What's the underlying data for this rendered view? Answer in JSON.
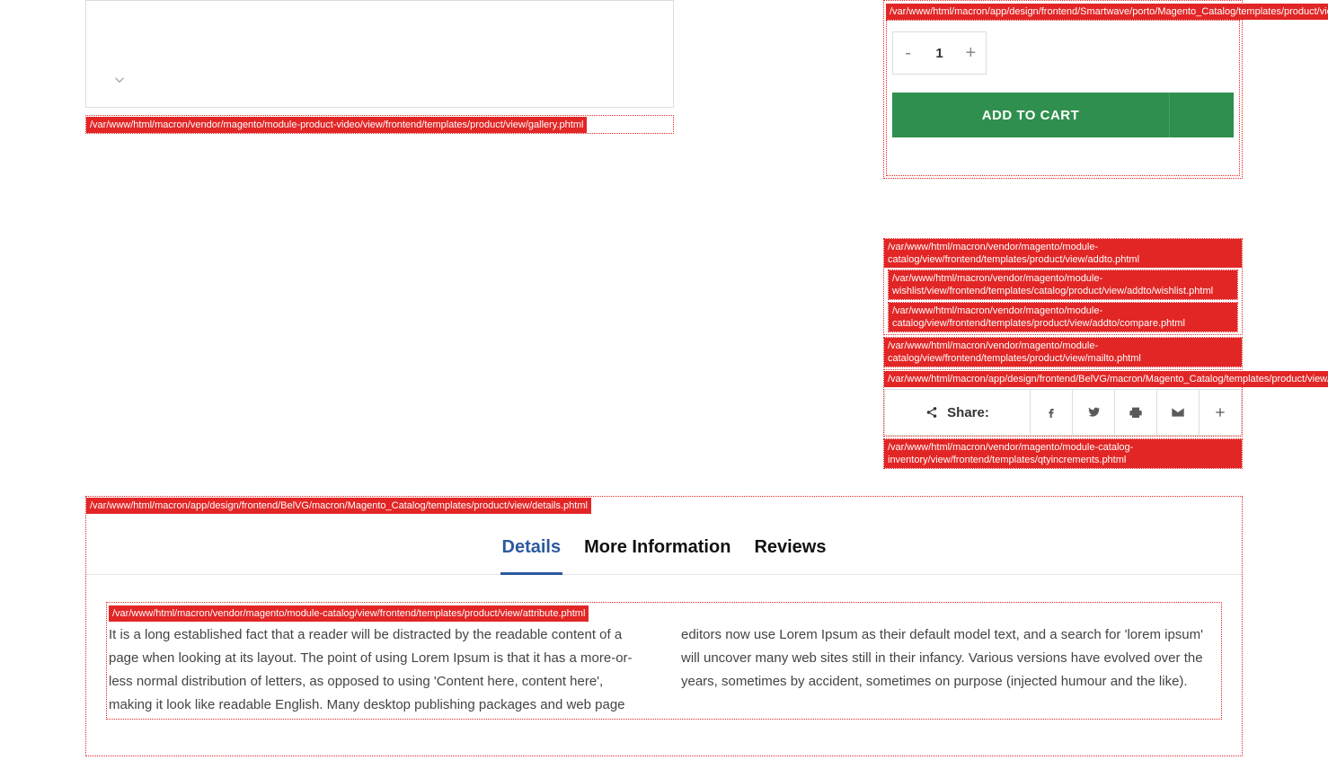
{
  "hints": {
    "addtocart": "/var/www/html/macron/app/design/frontend/Smartwave/porto/Magento_Catalog/templates/product/view/addtocart.phtml",
    "gallery": "/var/www/html/macron/vendor/magento/module-product-video/view/frontend/templates/product/view/gallery.phtml",
    "addto": "/var/www/html/macron/vendor/magento/module-catalog/view/frontend/templates/product/view/addto.phtml",
    "wishlist": "/var/www/html/macron/vendor/magento/module-wishlist/view/frontend/templates/catalog/product/view/addto/wishlist.phtml",
    "compare": "/var/www/html/macron/vendor/magento/module-catalog/view/frontend/templates/product/view/addto/compare.phtml",
    "mailto": "/var/www/html/macron/vendor/magento/module-catalog/view/frontend/templates/product/view/mailto.phtml",
    "addthis": "/var/www/html/macron/app/design/frontend/BelVG/macron/Magento_Catalog/templates/product/view/addthis.phtml",
    "qtyincrements": "/var/www/html/macron/vendor/magento/module-catalog-inventory/view/frontend/templates/qtyincrements.phtml",
    "details": "/var/www/html/macron/app/design/frontend/BelVG/macron/Magento_Catalog/templates/product/view/details.phtml",
    "attribute": "/var/www/html/macron/vendor/magento/module-catalog/view/frontend/templates/product/view/attribute.phtml"
  },
  "qty": {
    "minus": "-",
    "value": "1",
    "plus": "+"
  },
  "buttons": {
    "add_to_cart": "ADD TO CART"
  },
  "share": {
    "label": "Share:"
  },
  "tabs": {
    "details": "Details",
    "more_info": "More Information",
    "reviews": "Reviews"
  },
  "description": "It is a long established fact that a reader will be distracted by the readable content of a page when looking at its layout. The point of using Lorem Ipsum is that it has a more-or-less normal distribution of letters, as opposed to using 'Content here, content here', making it look like readable English. Many desktop publishing packages and web page editors now use Lorem Ipsum as their default model text, and a search for 'lorem ipsum' will uncover many web sites still in their infancy. Various versions have evolved over the years, sometimes by accident, sometimes on purpose (injected humour and the like)."
}
